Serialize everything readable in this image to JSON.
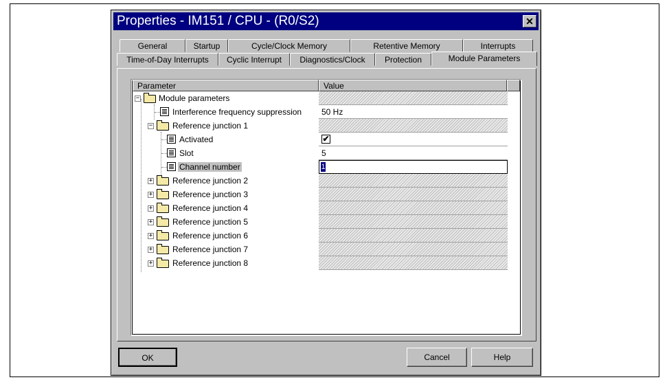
{
  "window": {
    "title": "Properties - IM151 / CPU - (R0/S2)",
    "close_symbol": "✕"
  },
  "tabs_row1": [
    "General",
    "Startup",
    "Cycle/Clock Memory",
    "Retentive Memory",
    "Interrupts"
  ],
  "tabs_row2": [
    "Time-of-Day Interrupts",
    "Cyclic Interrupt",
    "Diagnostics/Clock",
    "Protection",
    "Module Parameters"
  ],
  "active_tab": "Module Parameters",
  "table": {
    "col_parameter": "Parameter",
    "col_value": "Value",
    "rows": [
      {
        "label": "Module parameters",
        "icon": "folder-open-icon",
        "value": ""
      },
      {
        "label": "Interference frequency suppression",
        "icon": "parameter-icon",
        "value": "50 Hz"
      },
      {
        "label": "Reference junction 1",
        "icon": "folder-open-icon",
        "value": ""
      },
      {
        "label": "Activated",
        "icon": "parameter-icon",
        "value": "checked"
      },
      {
        "label": "Slot",
        "icon": "parameter-icon",
        "value": "5"
      },
      {
        "label": "Channel number",
        "icon": "parameter-icon",
        "value": "1"
      },
      {
        "label": "Reference junction 2",
        "icon": "folder-icon",
        "value": ""
      },
      {
        "label": "Reference junction 3",
        "icon": "folder-icon",
        "value": ""
      },
      {
        "label": "Reference junction 4",
        "icon": "folder-icon",
        "value": ""
      },
      {
        "label": "Reference junction 5",
        "icon": "folder-icon",
        "value": ""
      },
      {
        "label": "Reference junction 6",
        "icon": "folder-icon",
        "value": ""
      },
      {
        "label": "Reference junction 7",
        "icon": "folder-icon",
        "value": ""
      },
      {
        "label": "Reference junction 8",
        "icon": "folder-icon",
        "value": ""
      }
    ]
  },
  "buttons": {
    "ok": "OK",
    "cancel": "Cancel",
    "help": "Help"
  },
  "colors": {
    "titlebar": "#000080",
    "dialog_face": "#c0c0c0",
    "selection": "#000080"
  }
}
